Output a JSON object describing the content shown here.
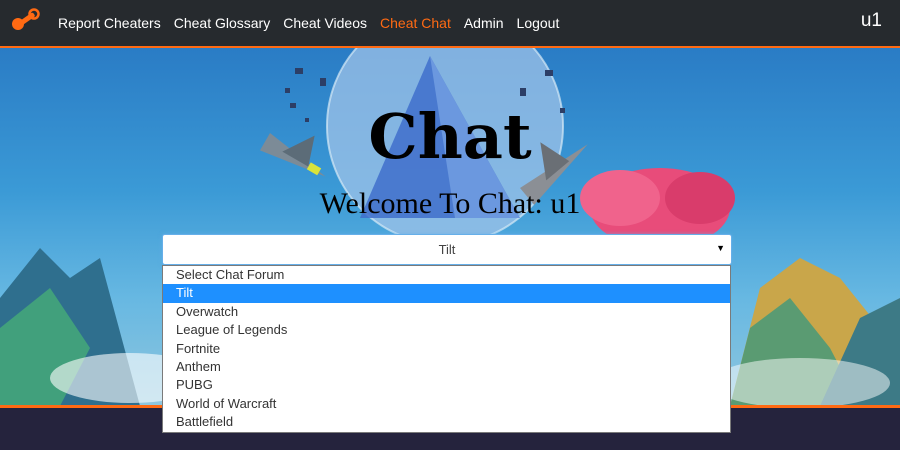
{
  "nav": {
    "links": [
      "Report Cheaters",
      "Cheat Glossary",
      "Cheat Videos",
      "Cheat Chat",
      "Admin",
      "Logout"
    ],
    "active_index": 3,
    "user": "u1"
  },
  "colors": {
    "accent": "#ff6a13",
    "navbar": "#262a2e",
    "highlight": "#1e90ff"
  },
  "hero": {
    "title": "Chat",
    "subtitle": "Welcome To Chat: u1"
  },
  "chat_select": {
    "selected": "Tilt",
    "options": [
      "Select Chat Forum",
      "Tilt",
      "Overwatch",
      "League of Legends",
      "Fortnite",
      "Anthem",
      "PUBG",
      "World of Warcraft",
      "Battlefield"
    ],
    "highlighted_index": 1
  }
}
